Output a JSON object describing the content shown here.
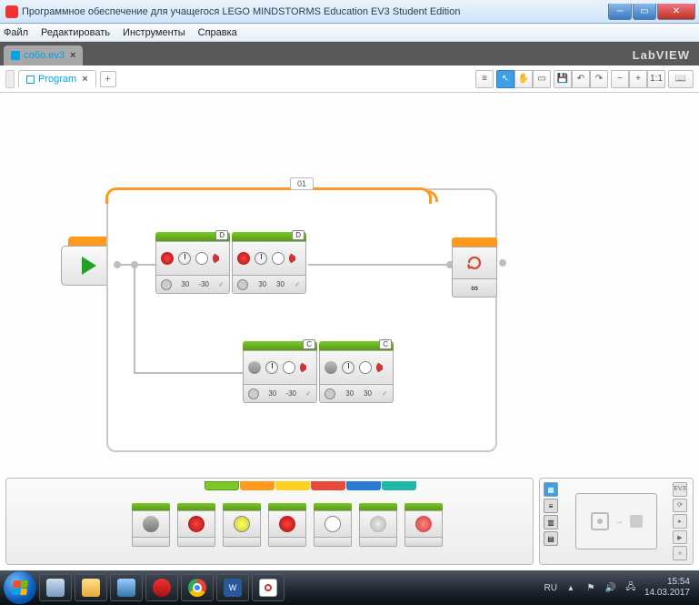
{
  "window": {
    "title": "Программное обеспечение для учащегося LEGO MINDSTORMS Education EV3 Student Edition"
  },
  "menu": {
    "file": "Файл",
    "edit": "Редактировать",
    "tools": "Инструменты",
    "help": "Справка"
  },
  "project": {
    "tab": "собо.ev3",
    "brand": "LabVIEW"
  },
  "program": {
    "tab": "Program"
  },
  "toolbar": {
    "list": "≡",
    "pointer": "↖",
    "pan": "✋",
    "comment": "▭",
    "save": "💾",
    "undo": "↶",
    "redo": "↷",
    "zoom_out": "−",
    "zoom_in": "+",
    "zoom_fit": "1:1",
    "docs": "📖"
  },
  "loop": {
    "label": "01",
    "end_mode": "∞"
  },
  "blocks": {
    "d1": {
      "port": "D",
      "p1": "30",
      "p2": "-30",
      "p3": "✓"
    },
    "d2": {
      "port": "D",
      "p1": "30",
      "p2": "30",
      "p3": "✓"
    },
    "c1": {
      "port": "C",
      "p1": "30",
      "p2": "-30",
      "p3": "✓"
    },
    "c2": {
      "port": "C",
      "p1": "30",
      "p2": "30",
      "p3": "✓"
    }
  },
  "palette": {
    "cats": [
      "green",
      "orange",
      "yellow",
      "red",
      "blue",
      "teal"
    ]
  },
  "hw": {
    "badge": "EV3"
  },
  "tray": {
    "lang": "RU",
    "time": "15:54",
    "date": "14.03.2017"
  }
}
